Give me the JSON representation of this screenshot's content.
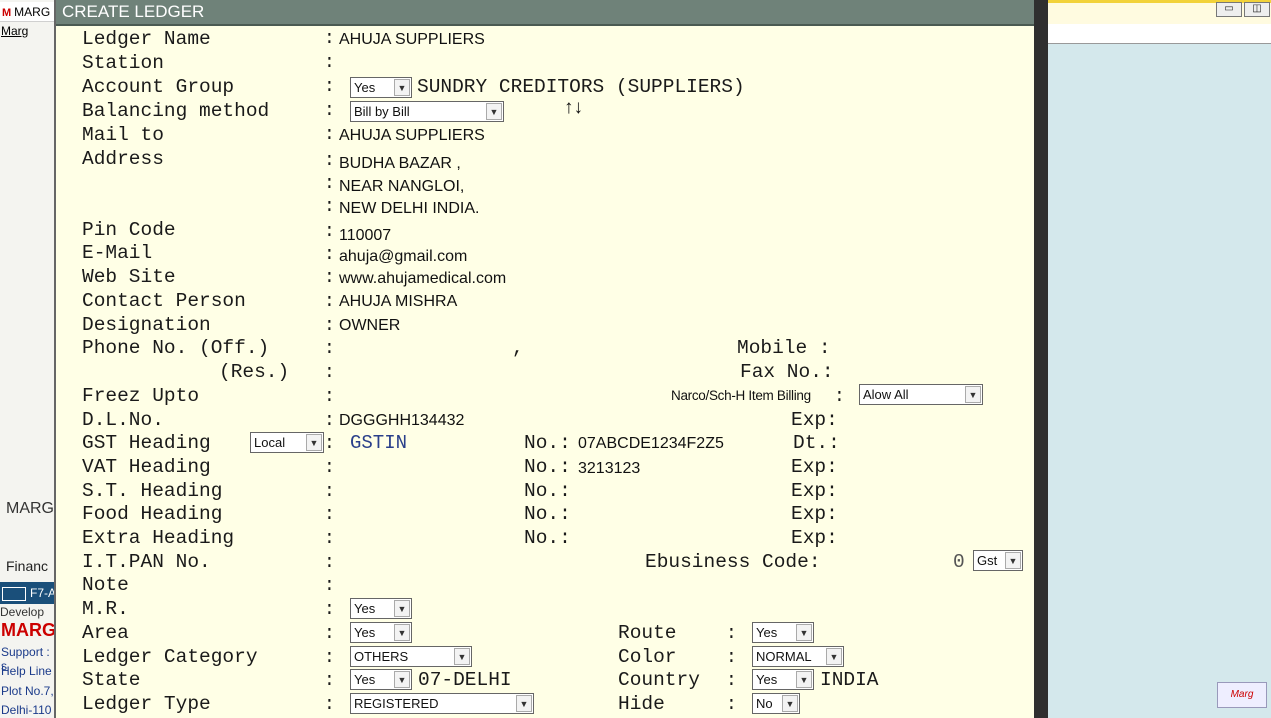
{
  "background_app": {
    "title": "MARG I",
    "menu": "Marg",
    "marg_label": "MARG",
    "financ_label": "Financ",
    "f7_label": "F7-A",
    "develop_label": "Develop",
    "marg_big": "MARG",
    "support": "Support : s",
    "helpline": "Help Line",
    "plot": "Plot No.7,",
    "delhi": "Delhi-110",
    "brand": "Marg"
  },
  "dialog": {
    "title": "CREATE LEDGER"
  },
  "labels": {
    "ledger_name": "Ledger Name",
    "station": "Station",
    "account_group": "Account Group",
    "balancing_method": "Balancing method",
    "mail_to": "Mail to",
    "address": "Address",
    "pin_code": "Pin Code",
    "email": "E-Mail",
    "web_site": "Web Site",
    "contact_person": "Contact Person",
    "designation": "Designation",
    "phone_off": "Phone No. (Off.)",
    "phone_res": "(Res.)",
    "mobile": "Mobile :",
    "fax": "Fax No.:",
    "freez_upto": "Freez Upto",
    "narco": "Narco/Sch-H Item Billing",
    "dl_no": "D.L.No.",
    "gst_heading": "GST  Heading",
    "vat_heading": "VAT  Heading",
    "st_heading": "S.T. Heading",
    "food_heading": "Food Heading",
    "extra_heading": "Extra Heading",
    "it_pan": "I.T.PAN No.",
    "ebusiness": "Ebusiness Code:",
    "note": "Note",
    "mr": "M.R.",
    "area": "Area",
    "route": "Route",
    "ledger_category": "Ledger Category",
    "color": "Color",
    "state": "State",
    "country": "Country",
    "ledger_type": "Ledger Type",
    "hide": "Hide",
    "no": "No.:",
    "exp": "Exp:",
    "dt": "Dt.:",
    "colon": ":"
  },
  "values": {
    "ledger_name": "AHUJA SUPPLIERS",
    "account_group_select": "Yes",
    "account_group": "SUNDRY CREDITORS (SUPPLIERS)",
    "balancing_method": "Bill by Bill",
    "sort_icon": "↑↓",
    "mail_to": "AHUJA SUPPLIERS",
    "address_line1": "BUDHA BAZAR ,",
    "address_line2": "NEAR NANGLOI,",
    "address_line3": "NEW DELHI INDIA.",
    "pin_code": "110007",
    "email": "ahuja@gmail.com",
    "web_site": "www.ahujamedical.com",
    "contact_person": "AHUJA MISHRA",
    "designation": "OWNER",
    "phone_comma": ",",
    "narco_select": "Alow All",
    "dl_no": "DGGGHH134432",
    "gst_select": "Local",
    "gstin_label": "GSTIN",
    "gstin_no": "07ABCDE1234F2Z5",
    "vat_no": "3213123",
    "ebusiness_code": "0",
    "ebusiness_select": "Gst",
    "mr": "Yes",
    "area": "Yes",
    "route": "Yes",
    "ledger_category": "OTHERS",
    "color": "NORMAL",
    "state_select": "Yes",
    "state": "07-DELHI",
    "country_select": "Yes",
    "country": "INDIA",
    "ledger_type": "REGISTERED",
    "hide": "No"
  },
  "icons": {
    "dropdown": "chevron-down-icon",
    "sort": "sort-arrows-icon"
  }
}
